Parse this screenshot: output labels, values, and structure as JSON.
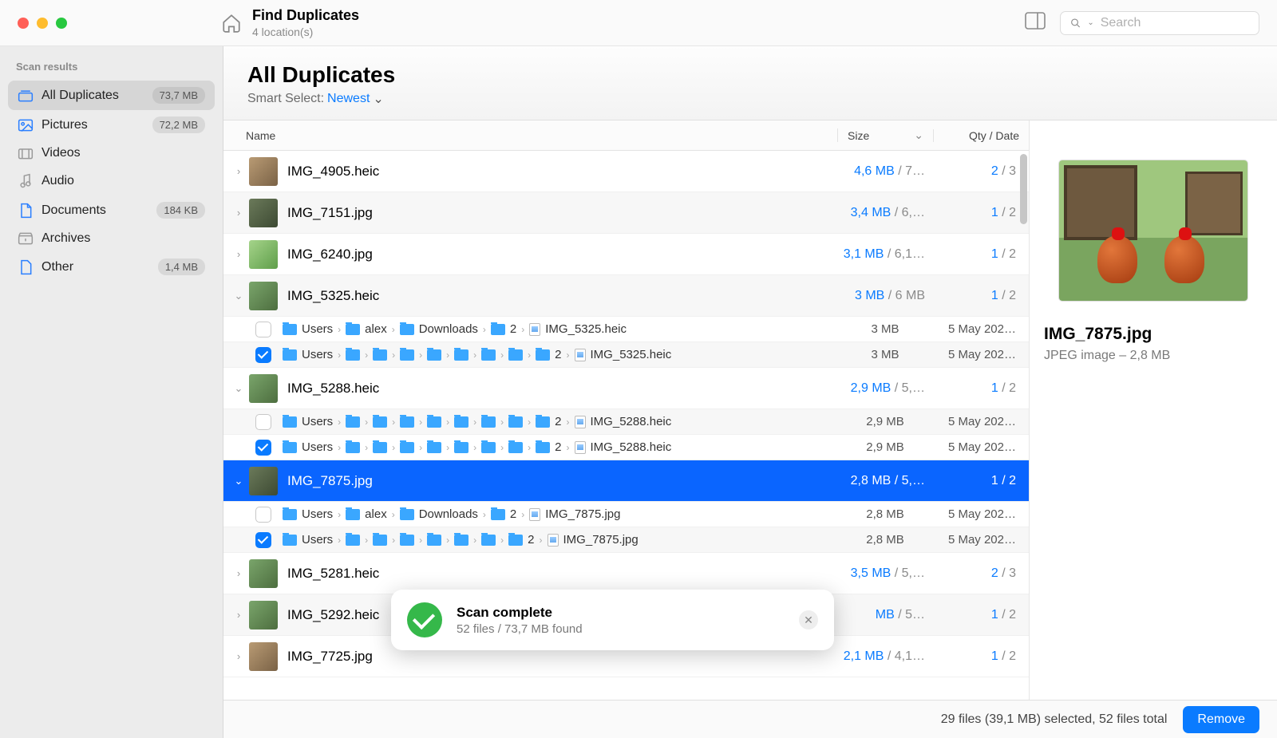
{
  "toolbar": {
    "title": "Find Duplicates",
    "subtitle": "4 location(s)",
    "search_placeholder": "Search"
  },
  "sidebar": {
    "header": "Scan results",
    "items": [
      {
        "label": "All Duplicates",
        "badge": "73,7 MB",
        "selected": true,
        "icon": "stack",
        "color": "blue"
      },
      {
        "label": "Pictures",
        "badge": "72,2 MB",
        "icon": "image",
        "color": "blue"
      },
      {
        "label": "Videos",
        "badge": "",
        "icon": "video",
        "color": "gray"
      },
      {
        "label": "Audio",
        "badge": "",
        "icon": "audio",
        "color": "gray"
      },
      {
        "label": "Documents",
        "badge": "184 KB",
        "icon": "doc",
        "color": "blue"
      },
      {
        "label": "Archives",
        "badge": "",
        "icon": "archive",
        "color": "gray"
      },
      {
        "label": "Other",
        "badge": "1,4 MB",
        "icon": "other",
        "color": "blue"
      }
    ]
  },
  "content": {
    "heading": "All Duplicates",
    "smart_label": "Smart Select:",
    "smart_value": "Newest",
    "cols": {
      "name": "Name",
      "size": "Size",
      "qty": "Qty / Date"
    }
  },
  "rows": [
    {
      "name": "IMG_4905.heic",
      "size_sel": "4,6 MB",
      "size_rest": " / 7…",
      "qty_sel": "2",
      "qty_rest": " / 3",
      "thumb": "brown",
      "chev": "›"
    },
    {
      "name": "IMG_7151.jpg",
      "size_sel": "3,4 MB",
      "size_rest": " / 6,…",
      "qty_sel": "1",
      "qty_rest": " / 2",
      "thumb": "dark",
      "chev": "›",
      "alt": true
    },
    {
      "name": "IMG_6240.jpg",
      "size_sel": "3,1 MB",
      "size_rest": " / 6,1…",
      "qty_sel": "1",
      "qty_rest": " / 2",
      "thumb": "bright",
      "chev": "›"
    },
    {
      "name": "IMG_5325.heic",
      "size_sel": "3 MB",
      "size_rest": " / 6 MB",
      "qty_sel": "1",
      "qty_rest": " / 2",
      "thumb": "",
      "chev": "⌄",
      "alt": true,
      "expanded": true,
      "paths": [
        {
          "checked": false,
          "segs": [
            "Users",
            "alex",
            "Downloads",
            "2"
          ],
          "file": "IMG_5325.heic",
          "size": "3 MB",
          "date": "5 May 202…"
        },
        {
          "checked": true,
          "segs": [
            "Users",
            "",
            "",
            "",
            "",
            "",
            "",
            "",
            "2"
          ],
          "file": "IMG_5325.heic",
          "size": "3 MB",
          "date": "5 May 202…",
          "alt": true
        }
      ]
    },
    {
      "name": "IMG_5288.heic",
      "size_sel": "2,9 MB",
      "size_rest": " / 5,…",
      "qty_sel": "1",
      "qty_rest": " / 2",
      "thumb": "",
      "chev": "⌄",
      "expanded": true,
      "paths": [
        {
          "checked": false,
          "segs": [
            "Users",
            "",
            "",
            "",
            "",
            "",
            "",
            "",
            "2"
          ],
          "file": "IMG_5288.heic",
          "size": "2,9 MB",
          "date": "5 May 202…",
          "alt": true
        },
        {
          "checked": true,
          "segs": [
            "Users",
            "",
            "",
            "",
            "",
            "",
            "",
            "",
            "2"
          ],
          "file": "IMG_5288.heic",
          "size": "2,9 MB",
          "date": "5 May 202…"
        }
      ]
    },
    {
      "name": "IMG_7875.jpg",
      "size_sel": "2,8 MB / 5,…",
      "size_rest": "",
      "qty_sel": "1 / 2",
      "qty_rest": "",
      "thumb": "dark",
      "chev": "⌄",
      "selected": true,
      "expanded": true,
      "paths": [
        {
          "checked": false,
          "segs": [
            "Users",
            "alex",
            "Downloads",
            "2"
          ],
          "file": "IMG_7875.jpg",
          "size": "2,8 MB",
          "date": "5 May 202…"
        },
        {
          "checked": true,
          "segs": [
            "Users",
            "",
            "",
            "",
            "",
            "",
            "",
            "2"
          ],
          "file": "IMG_7875.jpg",
          "size": "2,8 MB",
          "date": "5 May 202…",
          "alt": true
        }
      ]
    },
    {
      "name": "IMG_5281.heic",
      "size_sel": "3,5 MB",
      "size_rest": " / 5,…",
      "qty_sel": "2",
      "qty_rest": " / 3",
      "thumb": "",
      "chev": "›"
    },
    {
      "name": "IMG_5292.heic",
      "size_sel": "MB",
      "size_rest": " / 5…",
      "qty_sel": "1",
      "qty_rest": " / 2",
      "thumb": "",
      "chev": "›",
      "alt": true,
      "under_toast": true
    },
    {
      "name": "IMG_7725.jpg",
      "size_sel": "2,1 MB",
      "size_rest": " / 4,1…",
      "qty_sel": "1",
      "qty_rest": " / 2",
      "thumb": "brown",
      "chev": "›"
    }
  ],
  "preview": {
    "title": "IMG_7875.jpg",
    "subtitle": "JPEG image – 2,8 MB"
  },
  "footer": {
    "status": "29 files (39,1 MB) selected, 52 files total",
    "remove": "Remove"
  },
  "toast": {
    "title": "Scan complete",
    "subtitle": "52 files / 73,7 MB found"
  }
}
